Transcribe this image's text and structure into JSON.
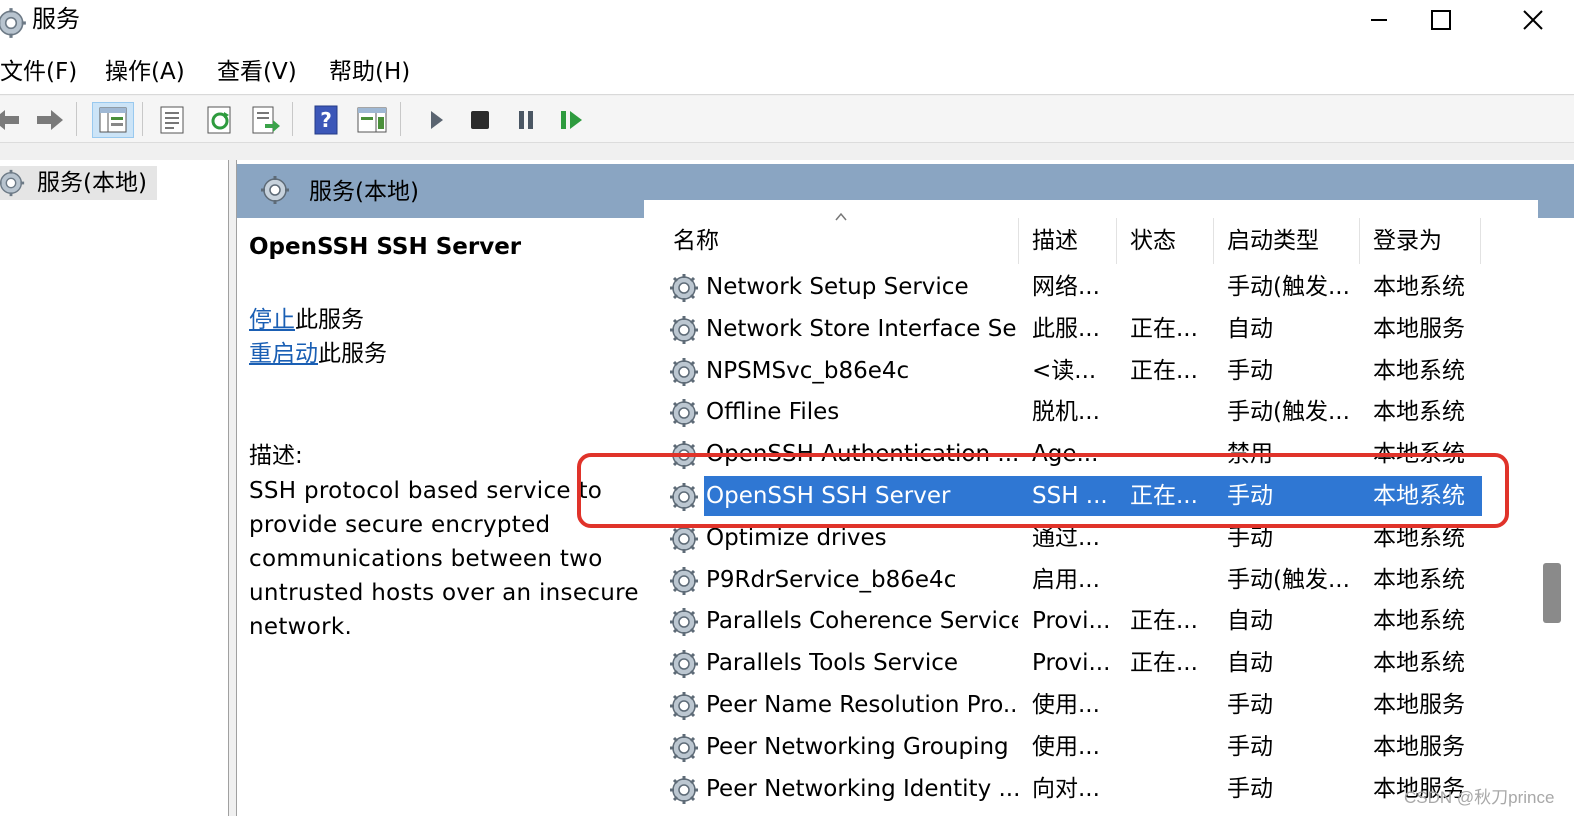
{
  "window": {
    "title": "服务",
    "minimize_glyph": "—",
    "maximize_glyph": "☐",
    "close_glyph": "✕"
  },
  "menu": {
    "file": "文件(F)",
    "action": "操作(A)",
    "view": "查看(V)",
    "help": "帮助(H)"
  },
  "toolbar": {
    "icons": [
      "back-arrow-icon",
      "forward-arrow-icon",
      "show-console-tree-icon",
      "properties-icon",
      "refresh-icon",
      "export-list-icon",
      "help-icon",
      "action-pane-icon",
      "start-service-icon",
      "stop-service-icon",
      "pause-service-icon",
      "restart-service-icon"
    ],
    "accent_color": "#2f77d3"
  },
  "tree": {
    "node_label": "服务(本地)"
  },
  "pane": {
    "header_title": "服务(本地)"
  },
  "details": {
    "service_name": "OpenSSH SSH Server",
    "stop_link": "停止",
    "stop_suffix": "此服务",
    "restart_link": "重启动",
    "restart_suffix": "此服务",
    "description_label": "描述:",
    "description_text": "SSH protocol based service to provide secure encrypted communications between two untrusted hosts over an insecure network."
  },
  "list": {
    "columns": {
      "name": "名称",
      "description": "描述",
      "status": "状态",
      "startup_type": "启动类型",
      "log_on_as": "登录为"
    },
    "rows": [
      {
        "name": "Network Setup Service",
        "description": "网络...",
        "status": "",
        "startup": "手动(触发...",
        "logon": "本地系统"
      },
      {
        "name": "Network Store Interface Se...",
        "description": "此服...",
        "status": "正在...",
        "startup": "自动",
        "logon": "本地服务"
      },
      {
        "name": "NPSMSvc_b86e4c",
        "description": "<读...",
        "status": "正在...",
        "startup": "手动",
        "logon": "本地系统"
      },
      {
        "name": "Offline Files",
        "description": "脱机...",
        "status": "",
        "startup": "手动(触发...",
        "logon": "本地系统"
      },
      {
        "name": "OpenSSH Authentication ...",
        "description": "Age...",
        "status": "",
        "startup": "禁用",
        "logon": "本地系统"
      },
      {
        "name": "OpenSSH SSH Server",
        "description": "SSH ...",
        "status": "正在...",
        "startup": "手动",
        "logon": "本地系统"
      },
      {
        "name": "Optimize drives",
        "description": "通过...",
        "status": "",
        "startup": "手动",
        "logon": "本地系统"
      },
      {
        "name": "P9RdrService_b86e4c",
        "description": "启用...",
        "status": "",
        "startup": "手动(触发...",
        "logon": "本地系统"
      },
      {
        "name": "Parallels Coherence Service",
        "description": "Provi...",
        "status": "正在...",
        "startup": "自动",
        "logon": "本地系统"
      },
      {
        "name": "Parallels Tools Service",
        "description": "Provi...",
        "status": "正在...",
        "startup": "自动",
        "logon": "本地系统"
      },
      {
        "name": "Peer Name Resolution Pro...",
        "description": "使用...",
        "status": "",
        "startup": "手动",
        "logon": "本地服务"
      },
      {
        "name": "Peer Networking Grouping",
        "description": "使用...",
        "status": "",
        "startup": "手动",
        "logon": "本地服务"
      },
      {
        "name": "Peer Networking Identity ...",
        "description": "向对...",
        "status": "",
        "startup": "手动",
        "logon": "本地服务"
      }
    ],
    "selected_row": 5,
    "highlight_color": "#e0332a"
  },
  "watermark": "CSDN @秋刀prince"
}
